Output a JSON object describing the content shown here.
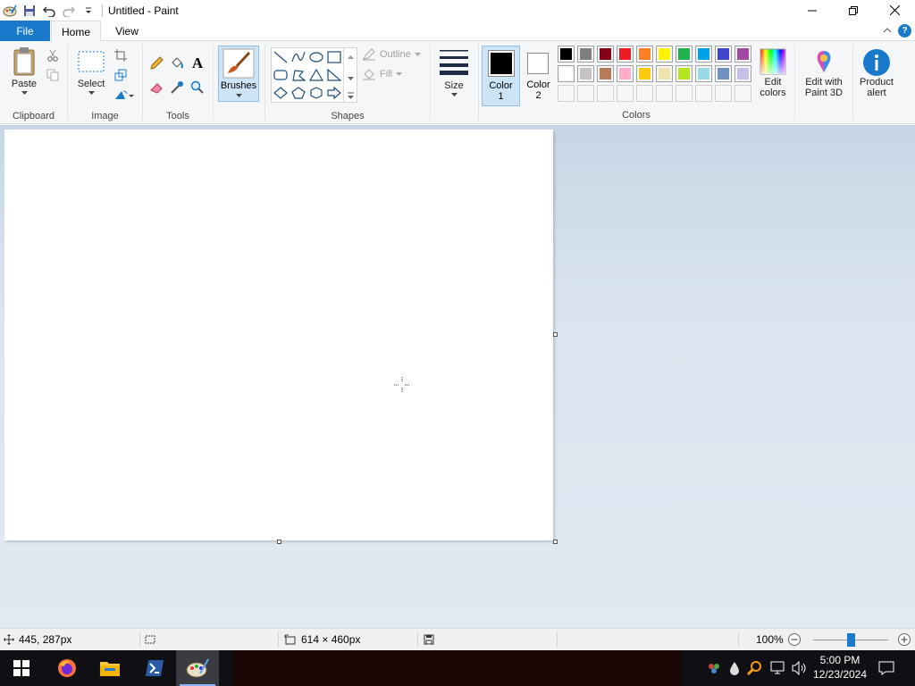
{
  "window": {
    "title": "Untitled - Paint"
  },
  "tabs": {
    "file": "File",
    "home": "Home",
    "view": "View"
  },
  "ribbon": {
    "clipboard": {
      "label": "Clipboard",
      "paste": "Paste"
    },
    "image": {
      "label": "Image",
      "select": "Select"
    },
    "tools": {
      "label": "Tools"
    },
    "brushes": {
      "label": "Brushes"
    },
    "shapes": {
      "label": "Shapes",
      "outline": "Outline",
      "fill": "Fill"
    },
    "size": {
      "label": "Size"
    },
    "colors": {
      "label": "Colors",
      "color1": "Color\n1",
      "color1_line1": "Color",
      "color1_line2": "1",
      "color2_line1": "Color",
      "color2_line2": "2",
      "color1_value": "#000000",
      "color2_value": "#ffffff",
      "palette_row1": [
        "#000000",
        "#7f7f7f",
        "#880015",
        "#ed1c24",
        "#ff7f27",
        "#fff200",
        "#22b14c",
        "#00a2e8",
        "#3f48cc",
        "#a349a4"
      ],
      "palette_row2": [
        "#ffffff",
        "#c3c3c3",
        "#b97a57",
        "#ffaec9",
        "#ffc90e",
        "#efe4b0",
        "#b5e61d",
        "#99d9ea",
        "#7092be",
        "#c8bfe7"
      ],
      "edit_colors_line1": "Edit",
      "edit_colors_line2": "colors",
      "paint3d_line1": "Edit with",
      "paint3d_line2": "Paint 3D",
      "alert_line1": "Product",
      "alert_line2": "alert"
    }
  },
  "status": {
    "cursor_pos": "445, 287px",
    "canvas_size": "614 × 460px",
    "zoom": "100%",
    "zoom_fraction": 0.5
  },
  "taskbar": {
    "time": "5:00 PM",
    "date": "12/23/2024"
  },
  "accent": "#1979ca"
}
